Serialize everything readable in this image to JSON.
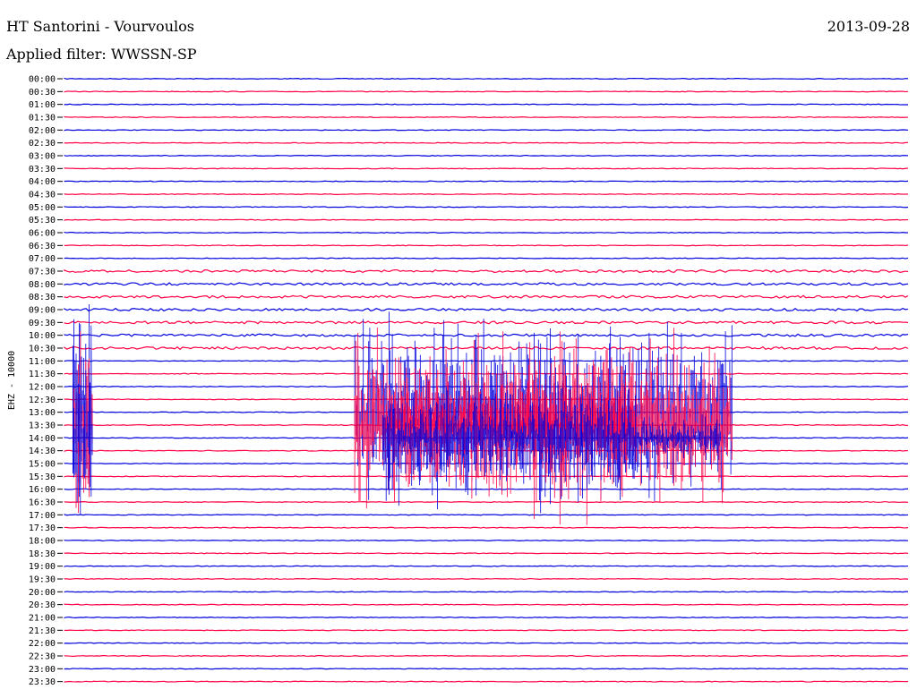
{
  "header": {
    "station": "HT Santorini - Vourvoulos",
    "filter": "Applied filter: WWSSN-SP",
    "date": "2013-09-28"
  },
  "chart_data": {
    "type": "line",
    "title": "HT Santorini - Vourvoulos",
    "subtitle": "Applied filter: WWSSN-SP",
    "date": "2013-09-28",
    "ylabel": "EHZ - 10000",
    "xlabel": "",
    "yticks": [
      "00:00",
      "00:30",
      "01:00",
      "01:30",
      "02:00",
      "02:30",
      "03:00",
      "03:30",
      "04:00",
      "04:30",
      "05:00",
      "05:30",
      "06:00",
      "06:30",
      "07:00",
      "07:30",
      "08:00",
      "08:30",
      "09:00",
      "09:30",
      "10:00",
      "10:30",
      "11:00",
      "11:30",
      "12:00",
      "12:30",
      "13:00",
      "13:30",
      "14:00",
      "14:30",
      "15:00",
      "15:30",
      "16:00",
      "16:30",
      "17:00",
      "17:30",
      "18:00",
      "18:30",
      "19:00",
      "19:30",
      "20:00",
      "20:30",
      "21:00",
      "21:30",
      "22:00",
      "22:30",
      "23:00",
      "23:30"
    ],
    "trace_minutes": 30,
    "x_minutes_range": [
      0,
      30
    ],
    "colors": {
      "even": "#0000dd",
      "odd": "#ff0044"
    },
    "grid": false,
    "noisy_interval_minutes": [
      450,
      660
    ],
    "bursts": [
      {
        "start_row": 26,
        "end_row": 28,
        "x_start_min": 0.3,
        "x_end_min": 1.0,
        "amplitude": 10
      },
      {
        "start_row": 26,
        "end_row": 27,
        "x_start_min": 10.3,
        "x_end_min": 23.7,
        "amplitude": 8
      },
      {
        "start_row": 27,
        "end_row": 28,
        "x_start_min": 11.3,
        "x_end_min": 20.3,
        "amplitude": 5
      },
      {
        "start_row": 28,
        "end_row": 28,
        "x_start_min": 20.3,
        "x_end_min": 23.3,
        "amplitude": 2
      }
    ]
  }
}
